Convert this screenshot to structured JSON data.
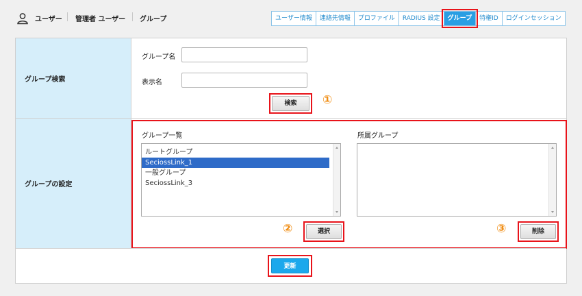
{
  "header": {
    "breadcrumb": [
      "ユーザー",
      "管理者 ユーザー",
      "グループ"
    ]
  },
  "tabs": [
    {
      "label": "ユーザー情報",
      "active": false
    },
    {
      "label": "連絡先情報",
      "active": false
    },
    {
      "label": "プロファイル",
      "active": false
    },
    {
      "label": "RADIUS 設定",
      "active": false
    },
    {
      "label": "グループ",
      "active": true
    },
    {
      "label": "特権ID",
      "active": false
    },
    {
      "label": "ログインセッション",
      "active": false
    }
  ],
  "search": {
    "section_label": "グループ検索",
    "group_name_label": "グループ名",
    "group_name_value": "",
    "display_name_label": "表示名",
    "display_name_value": "",
    "search_button": "検索",
    "marker": "①"
  },
  "settings": {
    "section_label": "グループの設定",
    "group_list_label": "グループ一覧",
    "group_list_items": [
      {
        "label": "ルートグループ",
        "selected": false
      },
      {
        "label": "SeciossLink_1",
        "selected": true
      },
      {
        "label": "一般グループ",
        "selected": false
      },
      {
        "label": "SeciossLink_3",
        "selected": false
      }
    ],
    "member_list_label": "所属グループ",
    "member_list_items": [],
    "select_button": "選択",
    "select_marker": "②",
    "delete_button": "削除",
    "delete_marker": "③"
  },
  "footer": {
    "update_button": "更新"
  },
  "colors": {
    "accent": "#2a9ee3",
    "highlight": "#e8131a",
    "marker": "#f08c12",
    "label_bg": "#d6eefa",
    "selection": "#2e6bc8"
  }
}
